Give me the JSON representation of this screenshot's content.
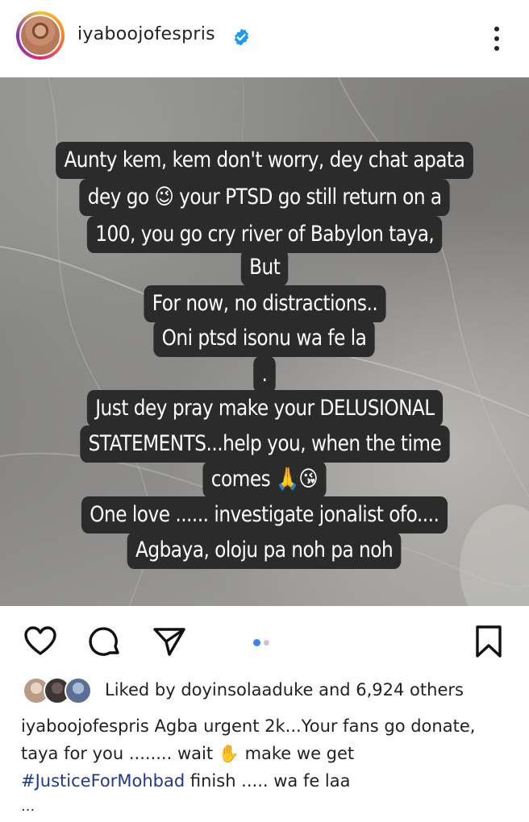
{
  "post": {
    "username": "iyaboojofespris",
    "verified": true,
    "story_text_lines": [
      "Aunty kem, kem don't worry, dey chat apata",
      "dey go 😉 your PTSD go still return on a",
      "100, you go cry river of Babylon taya,",
      "But",
      "For now, no distractions..",
      "Oni ptsd isonu wa fe la",
      ".",
      "Just dey pray make your DELUSIONAL",
      "STATEMENTS...help you, when the time",
      "comes 🙏😘",
      "One love ...... investigate jonalist ofo....",
      "Agbaya, oloju pa noh pa noh"
    ],
    "carousel": {
      "count": 2,
      "active_index": 0
    },
    "likes": {
      "prefix": "Liked by ",
      "user": "doyinsolaaduke",
      "suffix": " and 6,924 others"
    },
    "caption": {
      "username": "iyaboojofespris",
      "text_part1": " Agba urgent 2k...Your fans go donate, taya for you ........ wait ✋ make we get ",
      "hashtag": "#JusticeForMohbad",
      "text_part2": " finish ..... wa fe laa",
      "more": "..."
    }
  },
  "icons": {
    "more": "more-vertical-icon",
    "like": "heart-icon",
    "comment": "comment-icon",
    "share": "send-icon",
    "save": "bookmark-icon",
    "verified": "verified-badge-icon"
  },
  "colors": {
    "verified_blue": "#1d9bf0",
    "dot_active": "#3b82f6",
    "dot_inactive": "#c8c8c8",
    "hashtag": "#1e3a8a",
    "text_bg": "#2b2b2b"
  }
}
